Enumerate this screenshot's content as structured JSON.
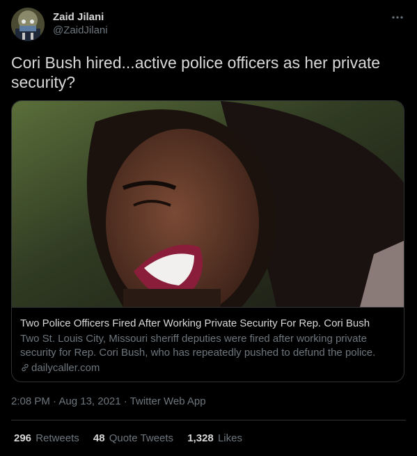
{
  "author": {
    "display_name": "Zaid Jilani",
    "handle": "@ZaidJilani",
    "avatar_icon": "avatar-image",
    "more_icon": "more-options-icon"
  },
  "tweet": {
    "text": "Cori Bush hired...active police officers as her private security?"
  },
  "card": {
    "title": "Two Police Officers Fired After Working Private Security For Rep. Cori Bush",
    "description": "Two St. Louis City, Missouri sheriff deputies were fired after working private security for Rep. Cori Bush, who has repeatedly pushed to defund the police.",
    "domain": "dailycaller.com",
    "link_icon": "link-icon"
  },
  "meta": {
    "timestamp": "2:08 PM · Aug 13, 2021 · Twitter Web App"
  },
  "stats": {
    "retweets_count": "296",
    "retweets_label": "Retweets",
    "quotes_count": "48",
    "quotes_label": "Quote Tweets",
    "likes_count": "1,328",
    "likes_label": "Likes"
  },
  "colors": {
    "background": "#000000",
    "text_primary": "#d9d9d9",
    "text_secondary": "#6e767d",
    "border": "#2f3336"
  }
}
